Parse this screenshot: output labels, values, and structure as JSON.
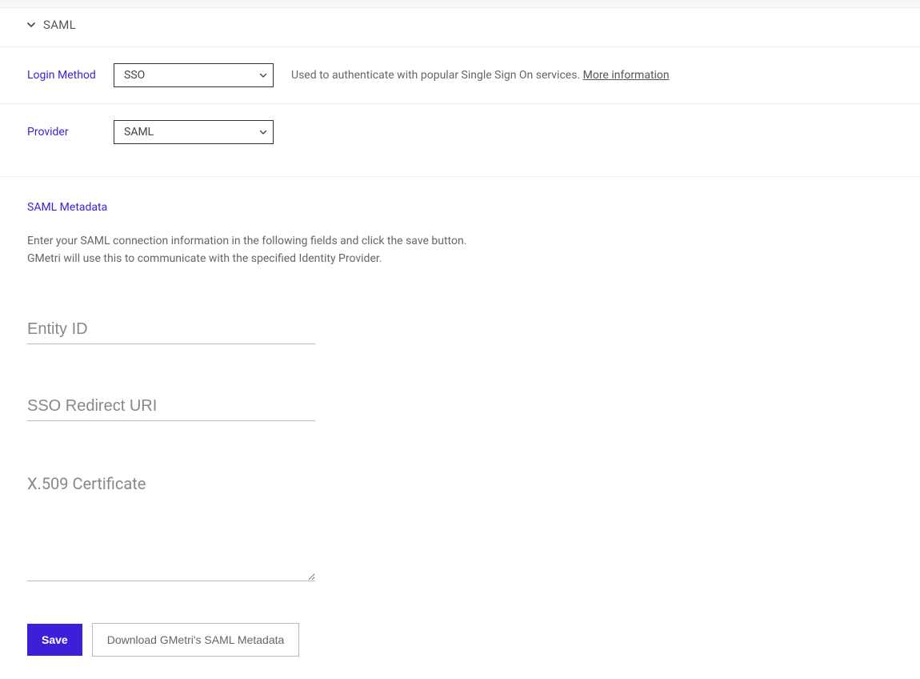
{
  "accordion": {
    "title": "SAML"
  },
  "login_method": {
    "label": "Login Method",
    "selected": "SSO",
    "help": "Used to authenticate with popular Single Sign On services. ",
    "link": "More information"
  },
  "provider": {
    "label": "Provider",
    "selected": "SAML"
  },
  "metadata": {
    "heading": "SAML Metadata",
    "desc_line1": "Enter your SAML connection information in the following fields and click the save button.",
    "desc_line2": "GMetri will use this to communicate with the specified Identity Provider."
  },
  "fields": {
    "entity_id": {
      "placeholder": "Entity ID",
      "value": ""
    },
    "sso_uri": {
      "placeholder": "SSO Redirect URI",
      "value": ""
    },
    "x509": {
      "placeholder": "X.509 Certificate",
      "value": ""
    }
  },
  "buttons": {
    "save": "Save",
    "download": "Download GMetri's SAML Metadata"
  }
}
